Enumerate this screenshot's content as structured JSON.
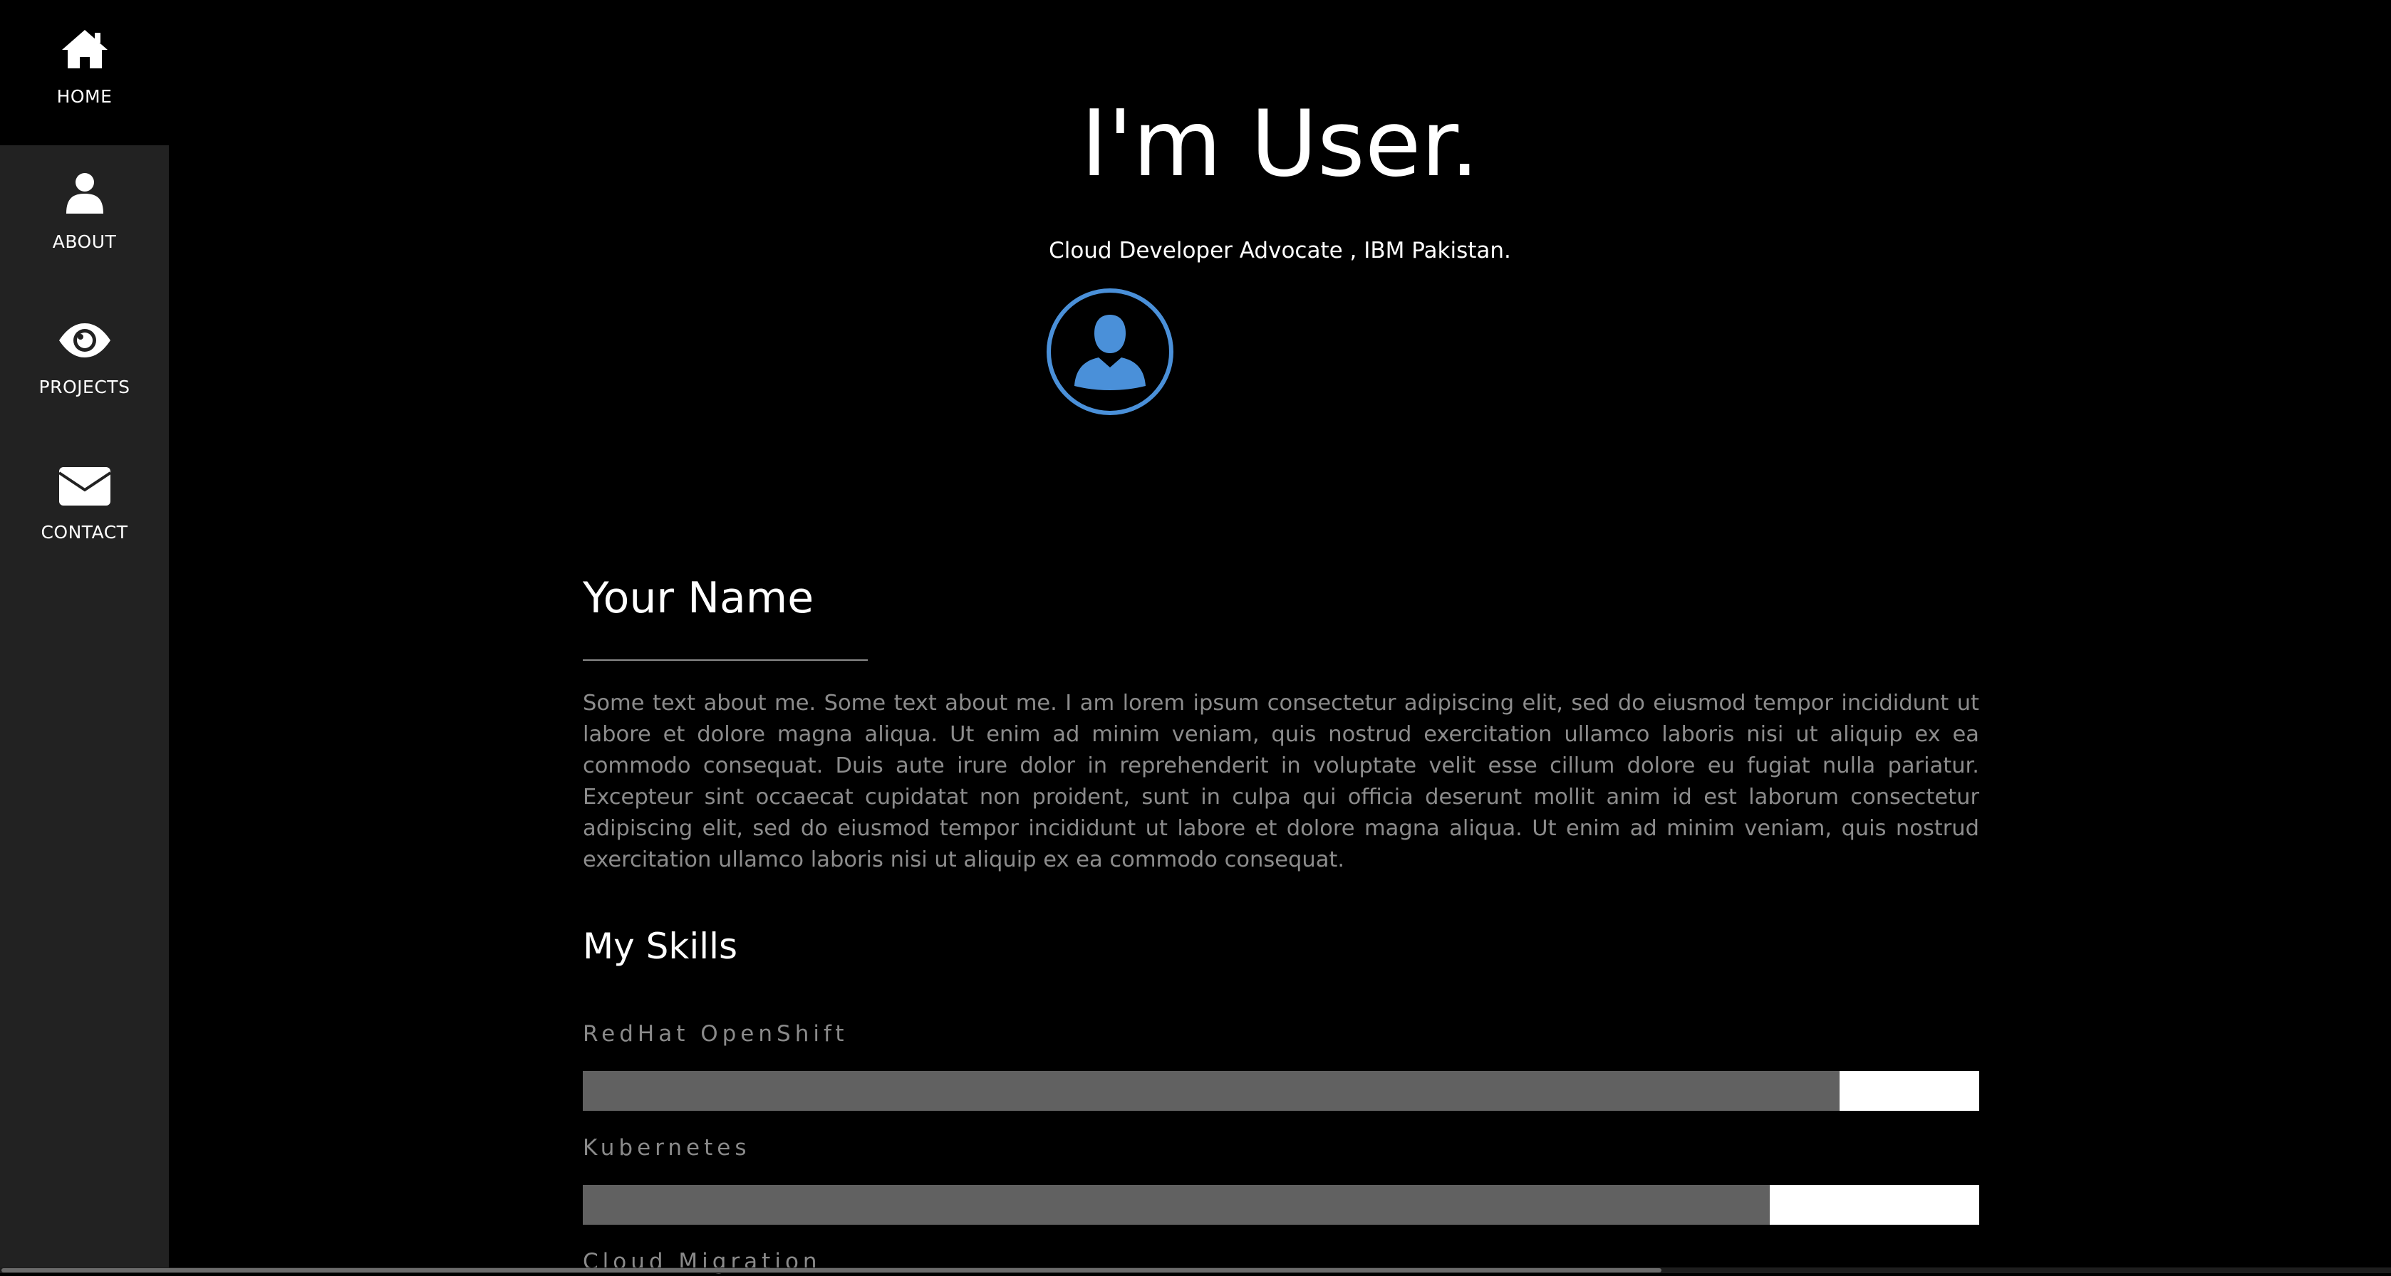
{
  "sidebar": {
    "items": [
      {
        "label": "HOME",
        "icon": "home-icon",
        "active": true
      },
      {
        "label": "ABOUT",
        "icon": "user-icon",
        "active": false
      },
      {
        "label": "PROJECTS",
        "icon": "eye-icon",
        "active": false
      },
      {
        "label": "CONTACT",
        "icon": "envelope-icon",
        "active": false
      }
    ]
  },
  "header": {
    "title": "I'm User.",
    "subtitle": "Cloud Developer Advocate , IBM Pakistan.",
    "avatar_icon": "user-avatar-icon",
    "avatar_color": "#4a90d9"
  },
  "about": {
    "heading": "Your Name",
    "text": "Some text about me. Some text about me. I am lorem ipsum consectetur adipiscing elit, sed do eiusmod tempor incididunt ut labore et dolore magna aliqua. Ut enim ad minim veniam, quis nostrud exercitation ullamco laboris nisi ut aliquip ex ea commodo consequat. Duis aute irure dolor in reprehenderit in voluptate velit esse cillum dolore eu fugiat nulla pariatur. Excepteur sint occaecat cupidatat non proident, sunt in culpa qui officia deserunt mollit anim id est laborum consectetur adipiscing elit, sed do eiusmod tempor incididunt ut labore et dolore magna aliqua. Ut enim ad minim veniam, quis nostrud exercitation ullamco laboris nisi ut aliquip ex ea commodo consequat."
  },
  "skills": {
    "heading": "My Skills",
    "items": [
      {
        "label": "RedHat OpenShift",
        "level": 0.9
      },
      {
        "label": "Kubernetes",
        "level": 0.85
      },
      {
        "label": "Cloud Migration",
        "level": null
      }
    ]
  },
  "colors": {
    "background": "#000000",
    "sidebar": "#222222",
    "bar_fill": "#616161",
    "bar_track": "#ffffff",
    "accent": "#4a90d9"
  }
}
